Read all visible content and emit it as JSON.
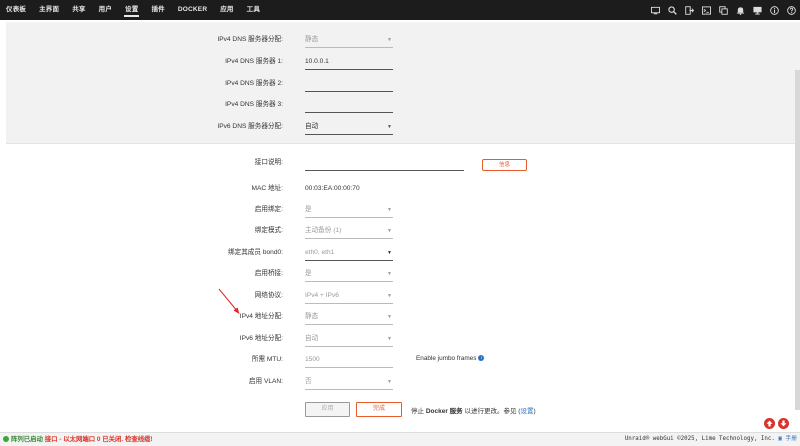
{
  "nav": {
    "items": [
      "仪表板",
      "主界面",
      "共享",
      "用户",
      "设置",
      "插件",
      "DOCKER",
      "应用",
      "工具"
    ],
    "active_index": 4,
    "icons": [
      "monitor-icon",
      "search-icon",
      "logout-icon",
      "terminal-icon",
      "copy-icon",
      "bell-icon",
      "display-icon",
      "info-icon",
      "help-icon"
    ]
  },
  "ipv4_dns_assign": {
    "label": "IPv4 DNS 服务器分配:",
    "value": "静态"
  },
  "ipv4_dns1": {
    "label": "IPv4 DNS 服务器 1:",
    "value": "10.0.0.1"
  },
  "ipv4_dns2": {
    "label": "IPv4 DNS 服务器 2:",
    "value": ""
  },
  "ipv4_dns3": {
    "label": "IPv4 DNS 服务器 3:",
    "value": ""
  },
  "ipv6_dns_assign": {
    "label": "IPv6 DNS 服务器分配:",
    "value": "自动"
  },
  "interface_desc": {
    "label": "接口说明:",
    "value": "",
    "info_button": "信息"
  },
  "mac": {
    "label": "MAC 地址:",
    "value": "00:03:EA:00:00:70"
  },
  "enable_bonding": {
    "label": "启用绑定:",
    "value": "是"
  },
  "bonding_mode": {
    "label": "绑定模式:",
    "value": "主动备份 (1)"
  },
  "bond_members": {
    "label": "绑定其成员 bond0:",
    "value": "eth0, eth1"
  },
  "enable_bridging": {
    "label": "启用桥接:",
    "value": "是"
  },
  "network_protocol": {
    "label": "网络协议:",
    "value": "IPv4 + IPv6"
  },
  "ipv4_assign": {
    "label": "IPv4 地址分配:",
    "value": "静态"
  },
  "ipv6_assign": {
    "label": "IPv6 地址分配:",
    "value": "自动"
  },
  "mtu": {
    "label": "所需 MTU:",
    "value": "1500",
    "jumbo": "Enable jumbo frames"
  },
  "enable_vlan": {
    "label": "启用 VLAN:",
    "value": "否"
  },
  "actions": {
    "apply": "应用",
    "done": "完成",
    "note_prefix": "停止 ",
    "note_bold": "Docker 服务",
    "note_middle": " 以进行更改。参见 (",
    "note_link": "设置",
    "note_suffix": ")"
  },
  "status": {
    "array": "阵列已启动",
    "warning": "接口 - 以太网端口 0 已关闭. 检查线缆!",
    "copyright": "Unraid® webGui ©2025, Lime Technology, Inc.",
    "manual": "手册"
  },
  "colors": {
    "accent": "#e85c2b",
    "nav_bg": "#1c1c1c",
    "link": "#2b6fc2",
    "ok": "#3aa53a",
    "warn": "#d9332a"
  }
}
